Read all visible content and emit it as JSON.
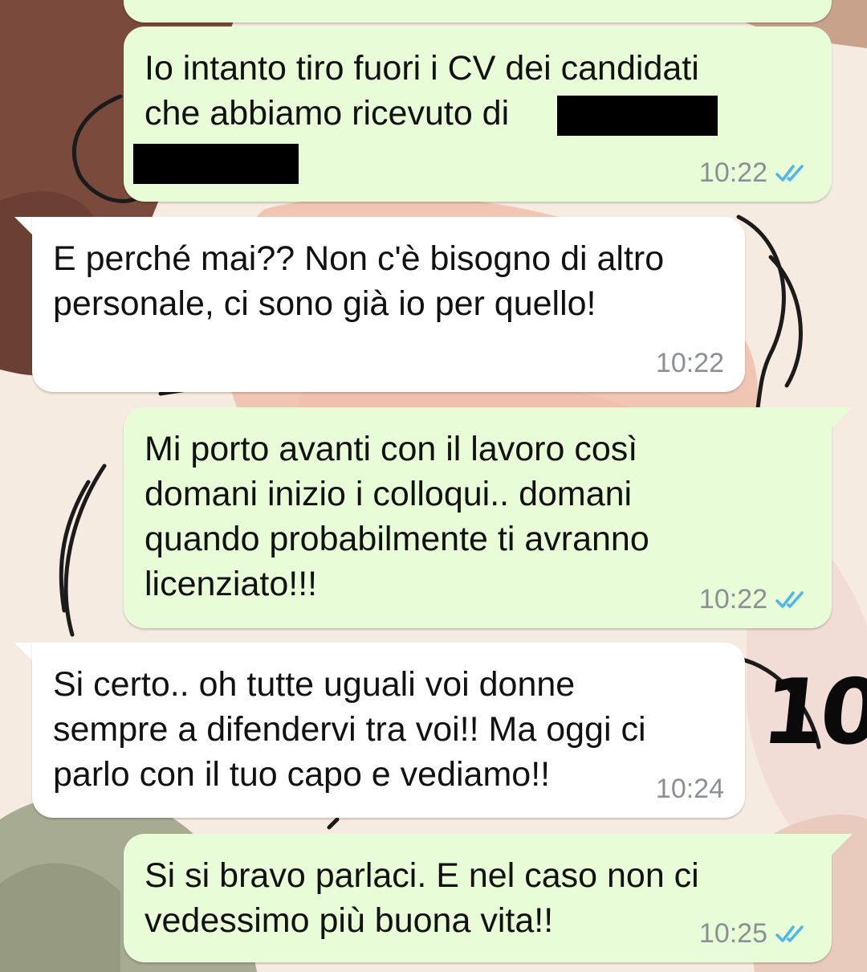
{
  "chat": {
    "messages": [
      {
        "direction": "outgoing",
        "text": "Io intanto tiro fuori i CV dei candidati\nche abbiamo ricevuto di",
        "time": "10:22",
        "status_icon": "double-check-read-icon"
      },
      {
        "direction": "incoming",
        "text": "E perché mai?? Non c'è bisogno di altro\npersonale, ci sono già io per quello!",
        "time": "10:22"
      },
      {
        "direction": "outgoing",
        "text": "Mi porto avanti con il lavoro così\ndomani inizio i colloqui.. domani\nquando probabilmente ti avranno\nlicenziato!!!",
        "time": "10:22",
        "status_icon": "double-check-read-icon"
      },
      {
        "direction": "incoming",
        "text": "Si certo.. oh tutte uguali voi donne\nsempre a difendervi tra voi!! Ma oggi ci\nparlo con il tuo capo e vediamo!!",
        "time": "10:24"
      },
      {
        "direction": "outgoing",
        "text": "Si si bravo parlaci. E nel caso non ci\nvedessimo più buona vita!!",
        "time": "10:25",
        "status_icon": "double-check-read-icon"
      }
    ]
  },
  "annotation": {
    "text": "10"
  },
  "colors": {
    "outgoing_bubble": "#e7fcd7",
    "incoming_bubble": "#ffffff",
    "read_ticks": "#4fb6ec",
    "timestamp": "#8c9096",
    "wallpaper_base": "#f4e6d8"
  }
}
